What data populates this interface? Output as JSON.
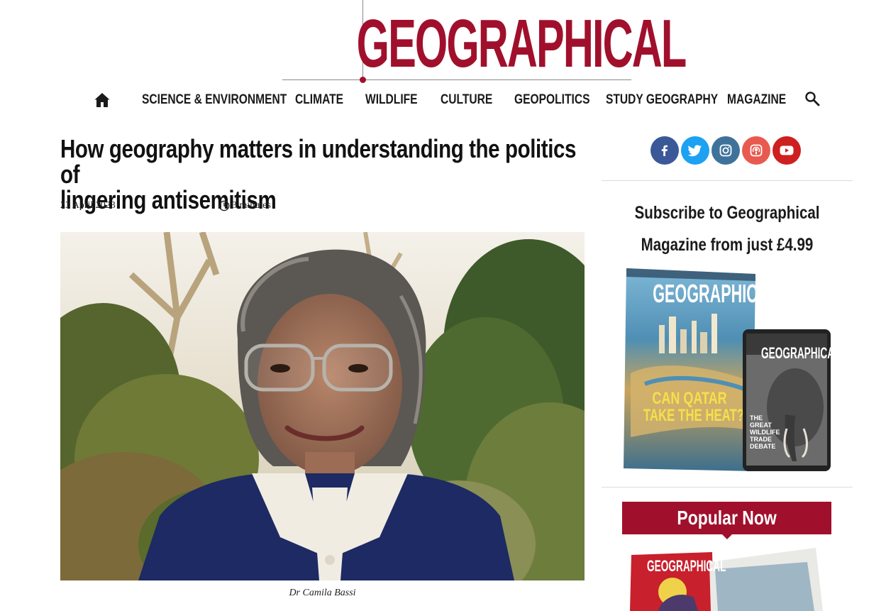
{
  "header": {
    "logo_text": "GEOGRAPHICAL",
    "brand_color": "#a0102c"
  },
  "nav": {
    "home_icon": "home-icon",
    "items": [
      {
        "label": "SCIENCE & ENVIRONMENT"
      },
      {
        "label": "CLIMATE"
      },
      {
        "label": "WILDLIFE"
      },
      {
        "label": "CULTURE"
      },
      {
        "label": "GEOPOLITICS"
      },
      {
        "label": "STUDY GEOGRAPHY"
      },
      {
        "label": "MAGAZINE"
      }
    ],
    "search_icon": "search-icon"
  },
  "article": {
    "title_line1": "How geography matters in understanding the politics of",
    "title_line2": "lingering antisemitism",
    "date": "23 April 2023",
    "read_time": "3 minutes",
    "image_caption": "Dr Camila Bassi"
  },
  "sidebar": {
    "social": [
      {
        "name": "facebook-icon",
        "color": "#3b5998"
      },
      {
        "name": "twitter-icon",
        "color": "#1da1f2"
      },
      {
        "name": "instagram-icon",
        "color": "#3f729b"
      },
      {
        "name": "podcast-icon",
        "color": "#e85a4f"
      },
      {
        "name": "youtube-icon",
        "color": "#cd201f"
      }
    ],
    "subscribe_line1": "Subscribe to Geographical",
    "subscribe_line2": "Magazine from just £4.99",
    "magazine": {
      "cover_title": "GEOGRAPHICAL",
      "cover_headline_1": "CAN QATAR",
      "cover_headline_2": "TAKE THE HEAT?",
      "tablet_title": "GEOGRAPHICAL",
      "tablet_headline_1": "THE",
      "tablet_headline_2": "GREAT",
      "tablet_headline_3": "WILDLIFE",
      "tablet_headline_4": "TRADE",
      "tablet_headline_5": "DEBATE"
    },
    "popular_title": "Popular Now",
    "popular_thumb_title": "GEOGRAPHICAL"
  }
}
